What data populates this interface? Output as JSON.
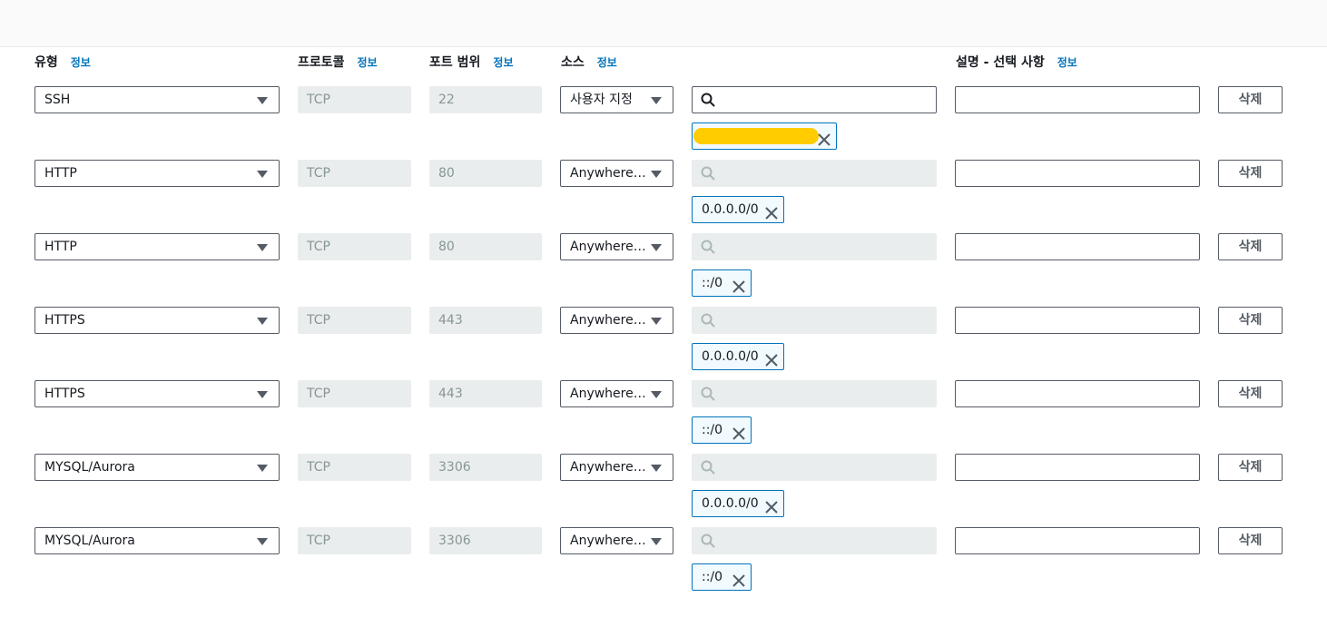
{
  "headers": {
    "type": "유형",
    "protocol": "프로토콜",
    "port_range": "포트 범위",
    "source": "소스",
    "description": "설명 - 선택 사항",
    "info": "정보"
  },
  "rules": [
    {
      "type": "SSH",
      "protocol": "TCP",
      "port": "22",
      "source": "사용자 지정",
      "cidr": "",
      "cidr_redacted": true,
      "delete": "삭제"
    },
    {
      "type": "HTTP",
      "protocol": "TCP",
      "port": "80",
      "source": "Anywhere-I...",
      "cidr": "0.0.0.0/0",
      "delete": "삭제"
    },
    {
      "type": "HTTP",
      "protocol": "TCP",
      "port": "80",
      "source": "Anywhere-I...",
      "cidr": "::/0",
      "delete": "삭제"
    },
    {
      "type": "HTTPS",
      "protocol": "TCP",
      "port": "443",
      "source": "Anywhere-I...",
      "cidr": "0.0.0.0/0",
      "delete": "삭제"
    },
    {
      "type": "HTTPS",
      "protocol": "TCP",
      "port": "443",
      "source": "Anywhere-I...",
      "cidr": "::/0",
      "delete": "삭제"
    },
    {
      "type": "MYSQL/Aurora",
      "protocol": "TCP",
      "port": "3306",
      "source": "Anywhere-I...",
      "cidr": "0.0.0.0/0",
      "delete": "삭제"
    },
    {
      "type": "MYSQL/Aurora",
      "protocol": "TCP",
      "port": "3306",
      "source": "Anywhere-I...",
      "cidr": "::/0",
      "delete": "삭제"
    }
  ],
  "icons": {
    "search": "search-icon",
    "remove": "close-icon",
    "dropdown": "caret-down-icon"
  }
}
